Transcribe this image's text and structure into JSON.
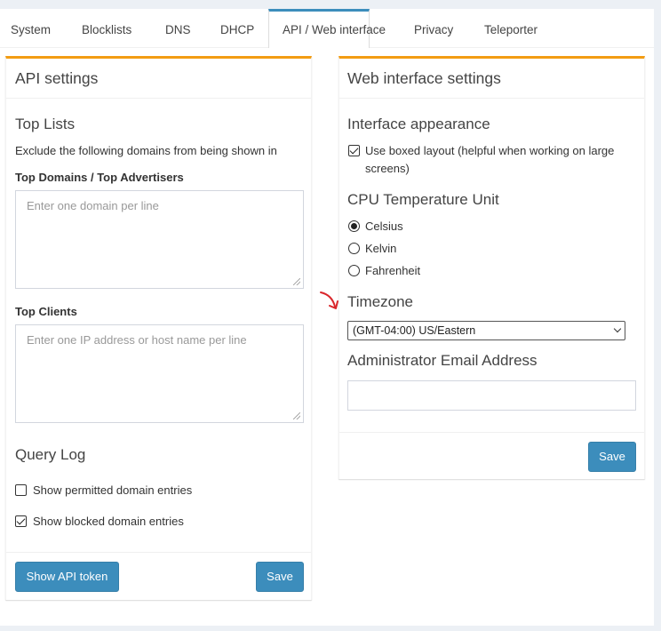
{
  "tabs": [
    {
      "label": "System"
    },
    {
      "label": "Blocklists"
    },
    {
      "label": "DNS"
    },
    {
      "label": "DHCP"
    },
    {
      "label": "API / Web interface"
    },
    {
      "label": "Privacy"
    },
    {
      "label": "Teleporter"
    }
  ],
  "api_settings": {
    "title": "API settings",
    "top_lists": {
      "heading": "Top Lists",
      "description": "Exclude the following domains from being shown in",
      "domains_label": "Top Domains / Top Advertisers",
      "domains_placeholder": "Enter one domain per line",
      "clients_label": "Top Clients",
      "clients_placeholder": "Enter one IP address or host name per line"
    },
    "query_log": {
      "heading": "Query Log",
      "show_permitted": {
        "label": "Show permitted domain entries",
        "checked": false
      },
      "show_blocked": {
        "label": "Show blocked domain entries",
        "checked": true
      }
    },
    "show_token_label": "Show API token",
    "save_label": "Save"
  },
  "web_settings": {
    "title": "Web interface settings",
    "appearance": {
      "heading": "Interface appearance",
      "boxed_layout_line1": "Use boxed layout (helpful when working on large",
      "boxed_layout_line2": "screens)",
      "boxed_checked": true
    },
    "cpu_temp": {
      "heading": "CPU Temperature Unit",
      "options": [
        {
          "label": "Celsius",
          "checked": true
        },
        {
          "label": "Kelvin",
          "checked": false
        },
        {
          "label": "Fahrenheit",
          "checked": false
        }
      ]
    },
    "timezone": {
      "heading": "Timezone",
      "selected": "(GMT-04:00) US/Eastern"
    },
    "admin_email": {
      "heading": "Administrator Email Address",
      "value": ""
    },
    "save_label": "Save"
  },
  "colors": {
    "accent": "#3c8dbc",
    "box_border": "#f39c12",
    "annotation_arrow": "#d9262b"
  }
}
